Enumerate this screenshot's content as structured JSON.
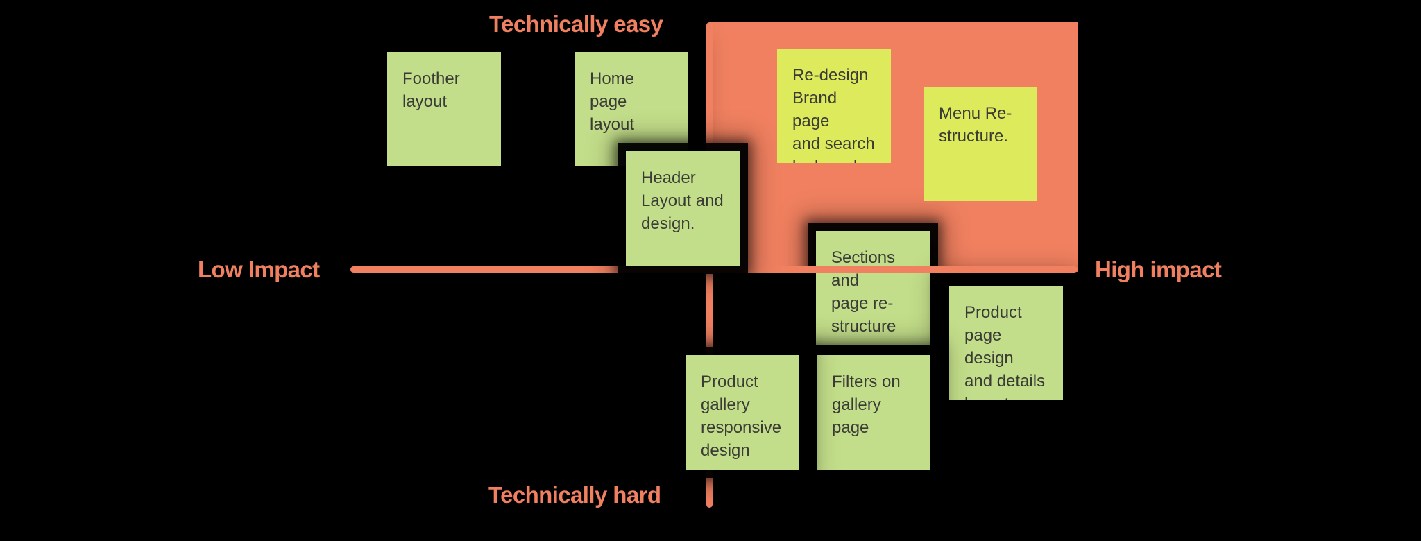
{
  "board": {
    "background_color": "#000000",
    "accent_color": "#F08060",
    "note_color": "#C3DE8A",
    "note_highlight_color": "#DDEA5C",
    "note_text_color": "#3b3b36"
  },
  "axes": {
    "top_label": "Technically easy",
    "bottom_label": "Technically hard",
    "left_label": "Low Impact",
    "right_label": "High impact"
  },
  "quadrant": {
    "name": "high-impact-technically-easy",
    "fill": "#F08060"
  },
  "notes": [
    {
      "id": "foother-layout",
      "text": "Foother\nlayout",
      "style": "green",
      "shadow": true
    },
    {
      "id": "home-page-layout",
      "text": "Home page\nlayout",
      "style": "green",
      "shadow": true
    },
    {
      "id": "header-layout",
      "text": "Header\nLayout and\ndesign.",
      "style": "green",
      "shadow": false
    },
    {
      "id": "redesign-brand-page",
      "text": "Re-design\nBrand page\nand search\nby brand",
      "style": "bright",
      "shadow": false
    },
    {
      "id": "menu-restructure",
      "text": "Menu Re-\nstructure.",
      "style": "bright",
      "shadow": false
    },
    {
      "id": "sections-restructure",
      "text": "Sections and\npage re-\nstructure",
      "style": "green",
      "shadow": true
    },
    {
      "id": "product-page-design",
      "text": "Product\npage design\nand details\nlayout",
      "style": "green",
      "shadow": true
    },
    {
      "id": "product-gallery",
      "text": "Product\ngallery\nresponsive\ndesign",
      "style": "green",
      "shadow": true
    },
    {
      "id": "filters-gallery-page",
      "text": "Filters on\ngallery page",
      "style": "green",
      "shadow": true
    }
  ]
}
